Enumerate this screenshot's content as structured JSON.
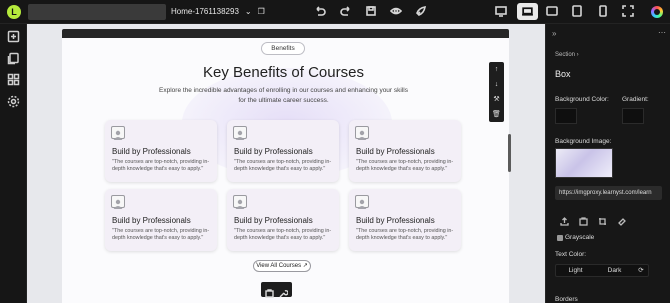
{
  "topbar": {
    "logo_letter": "L",
    "page_name": "Home-1761138293"
  },
  "canvas": {
    "badge": "Benefits",
    "title": "Key Benefits of Courses",
    "subtitle": "Explore the incredible advantages of enrolling in our courses and enhancing your skills for the ultimate career success.",
    "cards": [
      {
        "title": "Build by Professionals",
        "desc": "\"The courses are top-notch, providing in-depth knowledge that's easy to apply.\""
      },
      {
        "title": "Build by Professionals",
        "desc": "\"The courses are top-notch, providing in-depth knowledge that's easy to apply.\""
      },
      {
        "title": "Build by Professionals",
        "desc": "\"The courses are top-notch, providing in-depth knowledge that's easy to apply.\""
      },
      {
        "title": "Build by Professionals",
        "desc": "\"The courses are top-notch, providing in-depth knowledge that's easy to apply.\""
      },
      {
        "title": "Build by Professionals",
        "desc": "\"The courses are top-notch, providing in-depth knowledge that's easy to apply.\""
      },
      {
        "title": "Build by Professionals",
        "desc": "\"The courses are top-notch, providing in-depth knowledge that's easy to apply.\""
      }
    ],
    "view_all": "View All Courses ↗"
  },
  "panel": {
    "section_label": "Section ›",
    "element_name": "Box",
    "bg_color_label": "Background Color:",
    "gradient_label": "Gradient:",
    "bg_image_label": "Background Image:",
    "image_url": "https://imgproxy.learnyst.com/learn",
    "grayscale_label": "Grayscale",
    "text_color_label": "Text Color:",
    "light_label": "Light",
    "dark_label": "Dark",
    "next_section_cut": "Borders"
  },
  "colors": {
    "accent_logo": "#b5ea3c",
    "card_bg": "#f3eff7"
  }
}
